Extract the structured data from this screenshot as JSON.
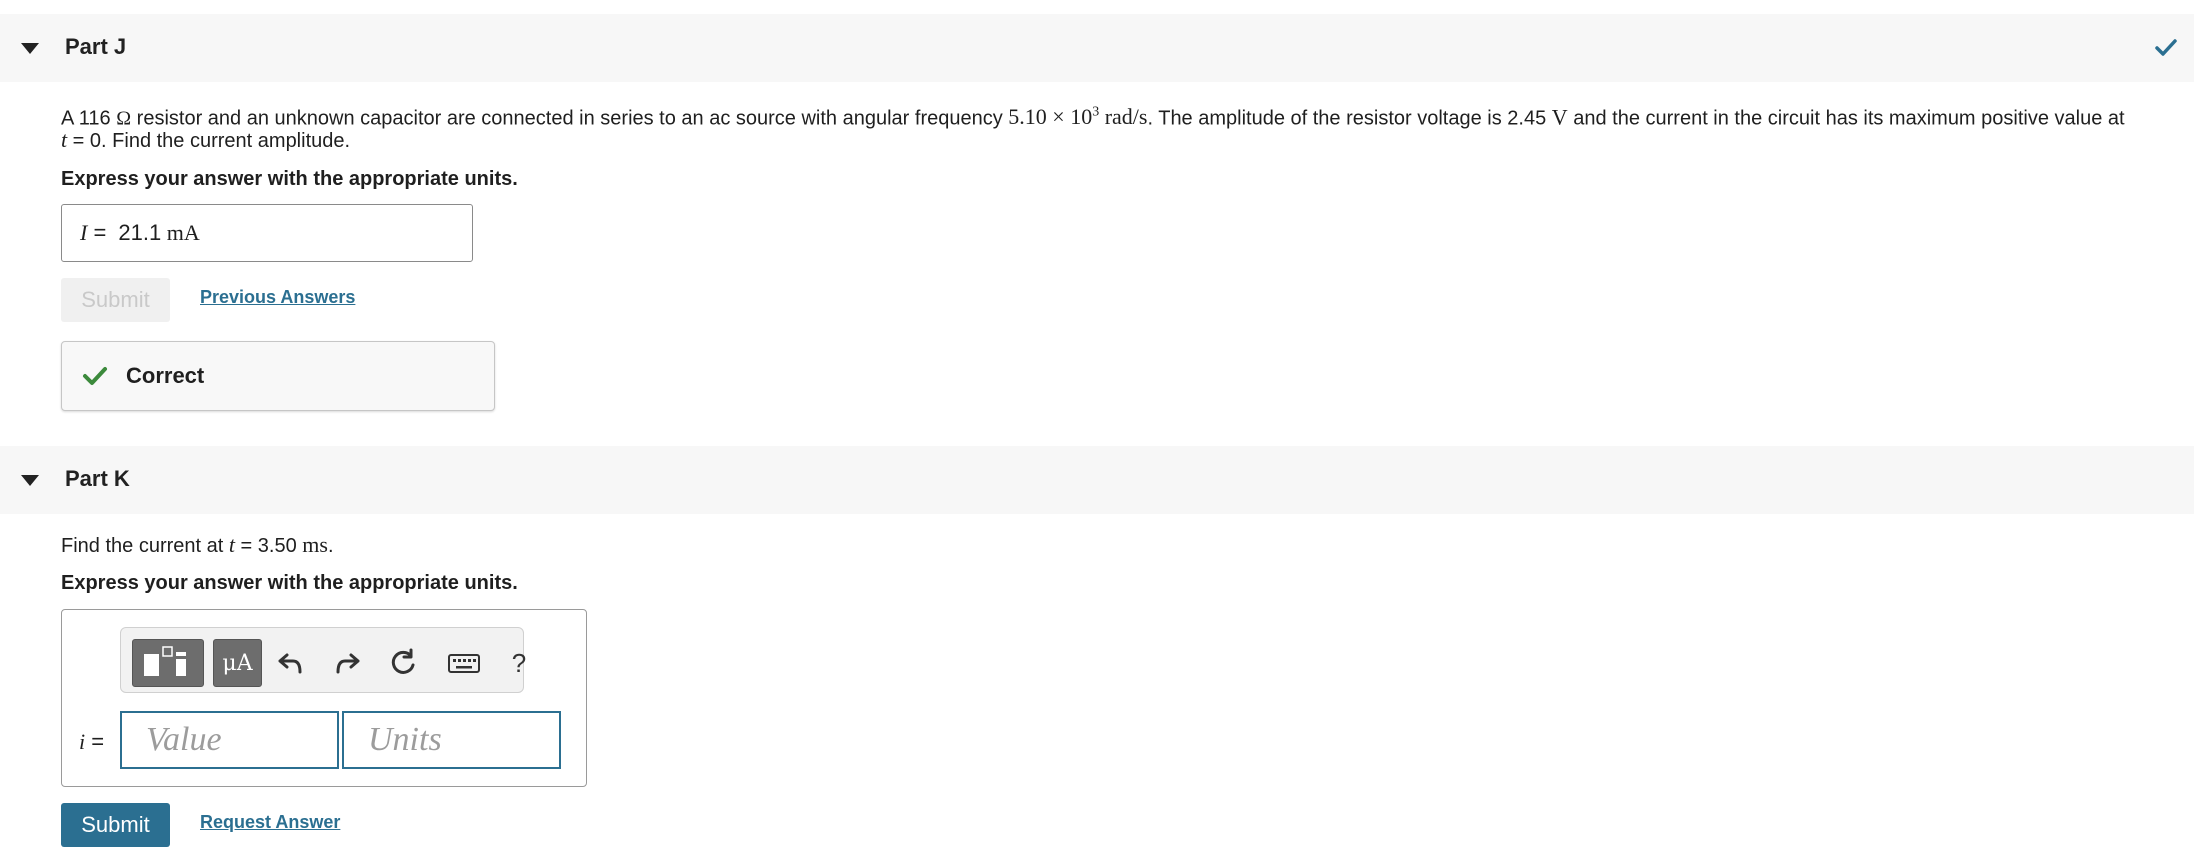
{
  "part_j": {
    "title": "Part J",
    "question_lines": [
      {
        "a": "A 116 ",
        "ohm": "Ω",
        "b": " resistor and an unknown capacitor are connected in series to an ac source with angular frequency ",
        "freq_mantissa": "5.10",
        "times": " × ",
        "freq_base": "10",
        "freq_exp": "3",
        "freq_unit": " rad/s",
        "c": ". The amplitude of the resistor voltage is 2.45 ",
        "volt_unit": "V",
        "d": " and the current in the circuit has its maximum positive value at"
      },
      {
        "t": "t",
        "e": " = 0. Find the current amplitude."
      }
    ],
    "instruction": "Express your answer with the appropriate units.",
    "answer": {
      "variable": "I",
      "equals": " = ",
      "value": "21.1",
      "unit": " mA"
    },
    "submit_label": "Submit",
    "previous_answers_label": "Previous Answers",
    "feedback_label": "Correct"
  },
  "part_k": {
    "title": "Part K",
    "question": {
      "a": "Find the current at ",
      "t": "t",
      "b": " = 3.50 ",
      "unit": "ms",
      "c": "."
    },
    "instruction": "Express your answer with the appropriate units.",
    "toolbar": {
      "units_label": "μA",
      "help_label": "?"
    },
    "variable": "i",
    "equals": " =",
    "value_placeholder": "Value",
    "units_placeholder": "Units",
    "submit_label": "Submit",
    "request_answer_label": "Request Answer"
  },
  "colors": {
    "accent": "#2b6f91",
    "correct_green": "#3c8a3c",
    "header_bg": "#f7f7f7"
  },
  "icons": [
    "caret-down-icon",
    "checkmark-icon",
    "undo-icon",
    "redo-icon",
    "reset-icon",
    "keyboard-icon",
    "templates-icon",
    "help-icon"
  ]
}
